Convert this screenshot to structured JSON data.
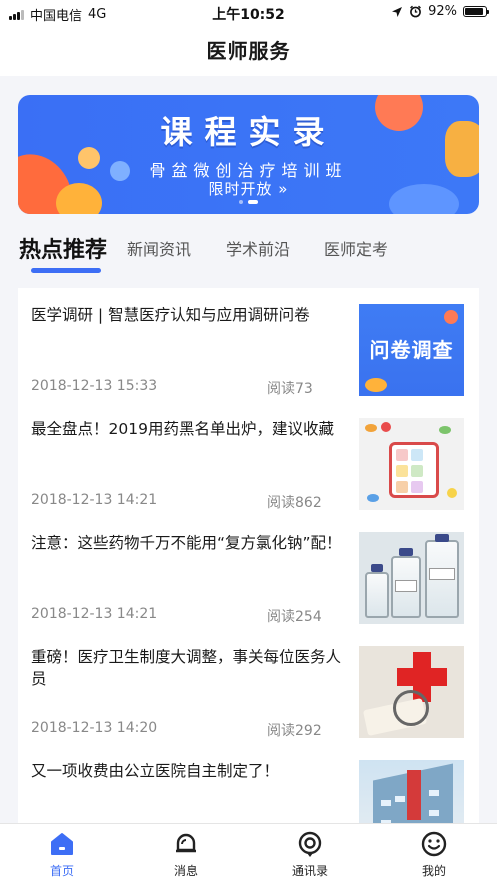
{
  "status_bar": {
    "carrier": "中国电信",
    "network": "4G",
    "time": "上午10:52",
    "battery": "92%",
    "battery_level": 0.92
  },
  "nav": {
    "title": "医师服务"
  },
  "banner": {
    "title": "课程实录",
    "subtitle": "骨盆微创治疗培训班",
    "cta": "限时开放 »",
    "pages": 2,
    "active_page": 2
  },
  "tabs": [
    {
      "label": "热点推荐",
      "active": true
    },
    {
      "label": "新闻资讯",
      "active": false
    },
    {
      "label": "学术前沿",
      "active": false
    },
    {
      "label": "医师定考",
      "active": false
    }
  ],
  "articles": [
    {
      "title": "医学调研 | 智慧医疗认知与应用调研问卷",
      "date": "2018-12-13 15:33",
      "reads": "阅读73",
      "thumb_text": "问卷调查",
      "thumb_icon": "survey-image"
    },
    {
      "title": "最全盘点！2019用药黑名单出炉，建议收藏",
      "date": "2018-12-13 14:21",
      "reads": "阅读862",
      "thumb_icon": "pill-box-image"
    },
    {
      "title": "注意：这些药物千万不能用“复方氯化钠”配！",
      "date": "2018-12-13 14:21",
      "reads": "阅读254",
      "thumb_icon": "iv-bottles-image"
    },
    {
      "title": "重磅！医疗卫生制度大调整，事关每位医务人员",
      "date": "2018-12-13 14:20",
      "reads": "阅读292",
      "thumb_icon": "medical-cross-image"
    },
    {
      "title": "又一项收费由公立医院自主制定了！",
      "thumb_icon": "hospital-building-image"
    }
  ],
  "tab_bar": [
    {
      "label": "首页",
      "icon": "home-icon",
      "active": true
    },
    {
      "label": "消息",
      "icon": "bell-icon",
      "active": false
    },
    {
      "label": "通讯录",
      "icon": "contacts-icon",
      "active": false
    },
    {
      "label": "我的",
      "icon": "smiley-icon",
      "active": false
    }
  ],
  "colors": {
    "accent": "#3d6ef5",
    "banner": "#3b74f6"
  }
}
